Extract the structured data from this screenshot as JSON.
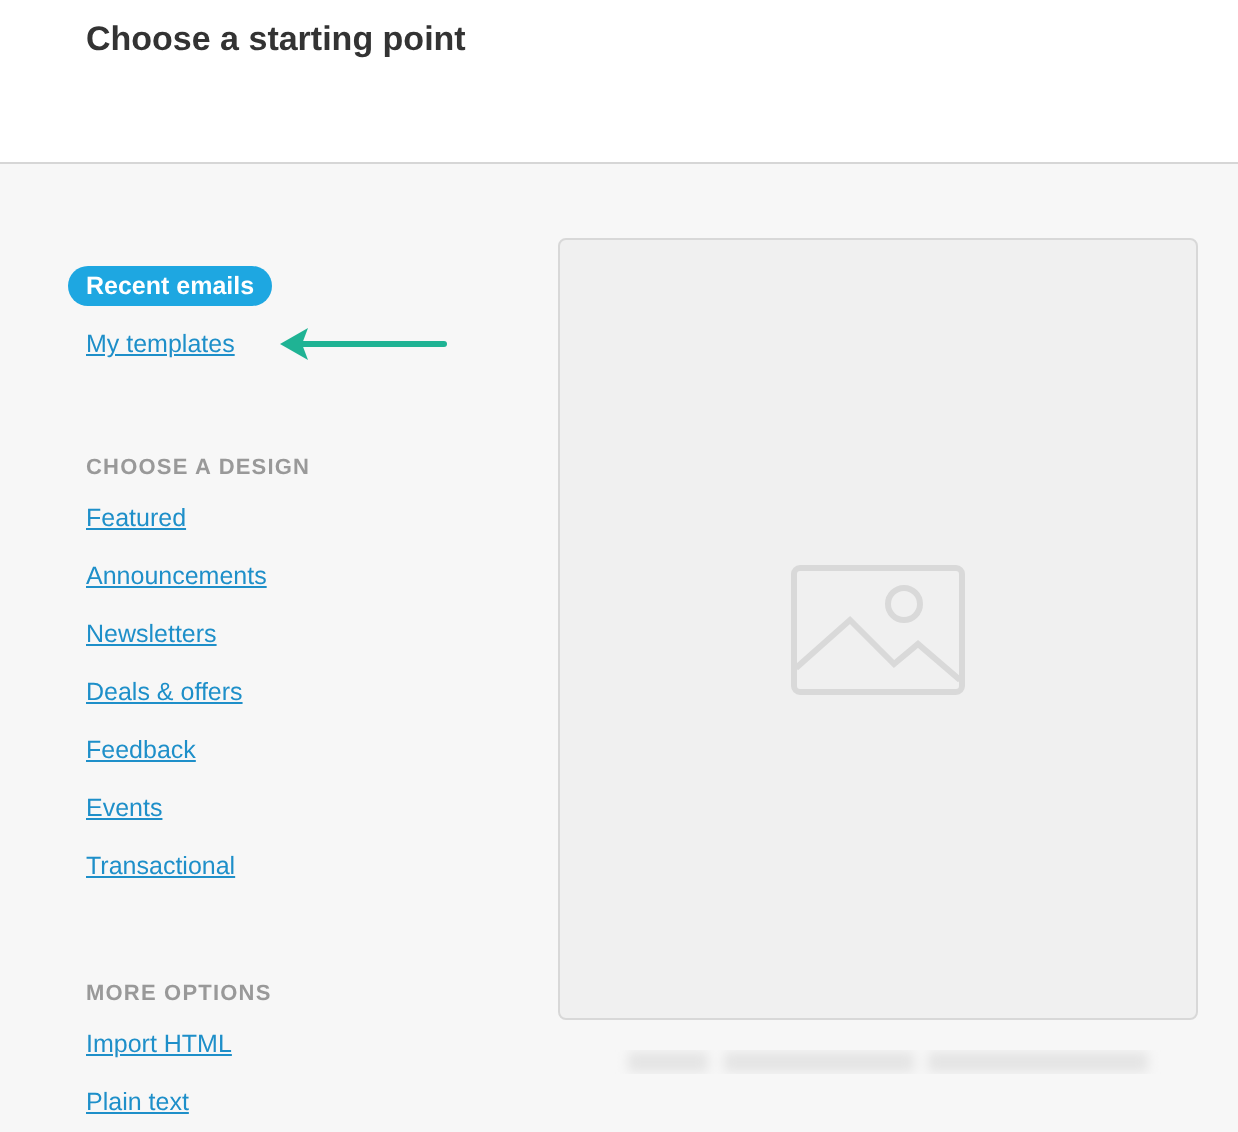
{
  "header": {
    "title": "Choose a starting point"
  },
  "nav": [
    {
      "label": "Recent emails",
      "selected": true
    },
    {
      "label": "My templates",
      "selected": false
    }
  ],
  "sections": [
    {
      "heading": "CHOOSE A DESIGN",
      "links": [
        "Featured",
        "Announcements",
        "Newsletters",
        "Deals & offers",
        "Feedback",
        "Events",
        "Transactional"
      ]
    },
    {
      "heading": "MORE OPTIONS",
      "links": [
        "Import HTML",
        "Plain text"
      ]
    }
  ]
}
